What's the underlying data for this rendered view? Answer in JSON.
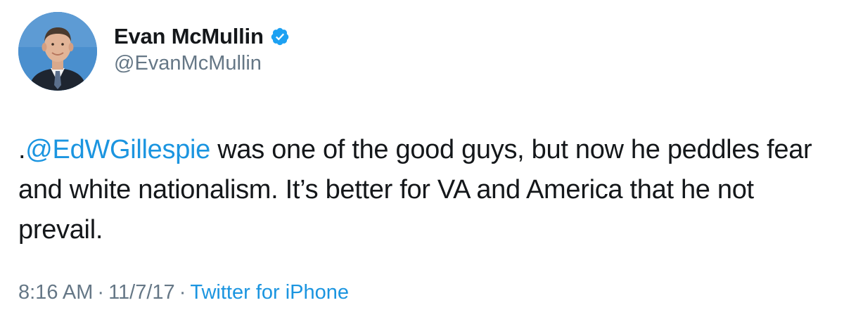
{
  "user": {
    "display_name": "Evan McMullin",
    "handle": "@EvanMcMullin",
    "verified": true
  },
  "tweet": {
    "prefix": ".",
    "mention": "@EdWGillespie",
    "text": " was one of the good guys, but now he peddles fear and white nationalism. It’s better for VA and America that he not prevail.",
    "time": "8:16 AM",
    "separator": "·",
    "date": "11/7/17",
    "source": "Twitter for iPhone"
  },
  "colors": {
    "link": "#1b95e0",
    "secondary": "#657786",
    "verified_badge": "#1da1f2"
  }
}
